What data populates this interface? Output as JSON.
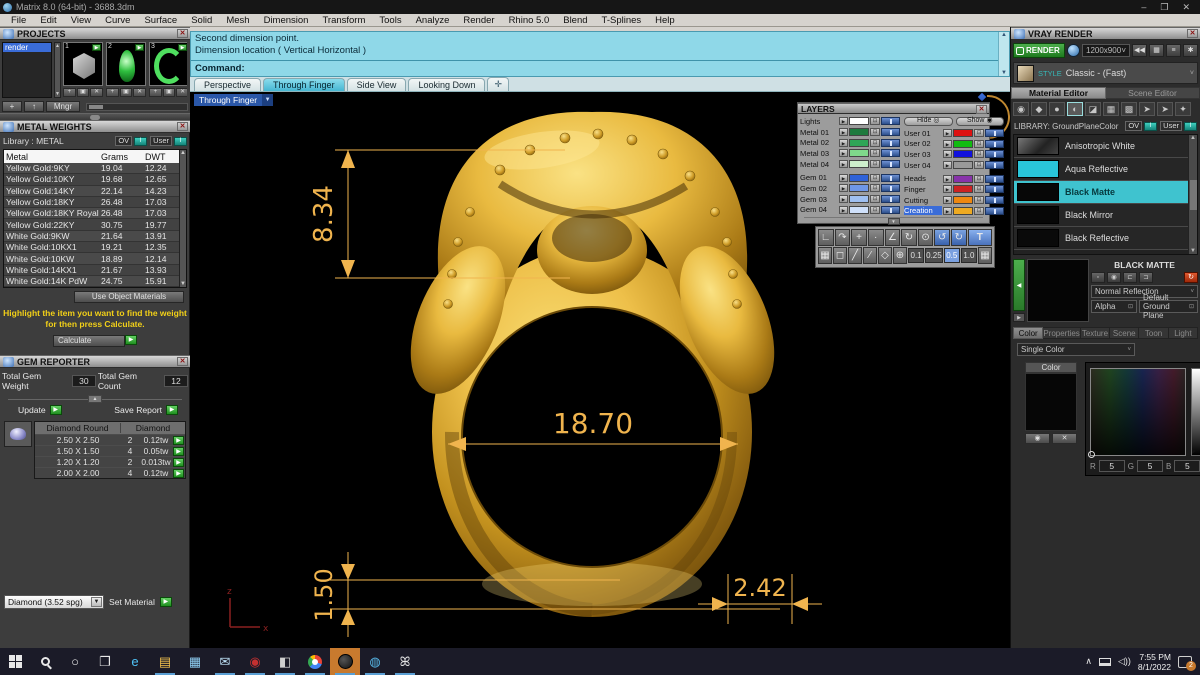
{
  "window": {
    "title": "Matrix 8.0 (64-bit) - 3688.3dm",
    "minimize": "–",
    "maximize": "❒",
    "close": "✕"
  },
  "menu": [
    "File",
    "Edit",
    "View",
    "Curve",
    "Surface",
    "Solid",
    "Mesh",
    "Dimension",
    "Transform",
    "Tools",
    "Analyze",
    "Render",
    "Rhino 5.0",
    "Blend",
    "T-Splines",
    "Help"
  ],
  "projects": {
    "title": "PROJECTS",
    "items": [
      {
        "label": "render",
        "selected": true
      }
    ],
    "thumbs": [
      {
        "label": "1"
      },
      {
        "label": "2"
      },
      {
        "label": "3"
      }
    ],
    "add_label": "+",
    "up_label": "↑",
    "mngr_label": "Mngr"
  },
  "metal_weights": {
    "title": "METAL WEIGHTS",
    "library_label": "Library :  METAL",
    "ov_label": "OV",
    "user_label": "User",
    "columns": [
      "Metal",
      "Grams",
      "DWT"
    ],
    "rows": [
      [
        "Yellow Gold:9KY",
        "19.04",
        "12.24"
      ],
      [
        "Yellow Gold:10KY",
        "19.68",
        "12.65"
      ],
      [
        "Yellow Gold:14KY",
        "22.14",
        "14.23"
      ],
      [
        "Yellow Gold:18KY",
        "26.48",
        "17.03"
      ],
      [
        "Yellow Gold:18KY Royal",
        "26.48",
        "17.03"
      ],
      [
        "Yellow Gold:22KY",
        "30.75",
        "19.77"
      ],
      [
        "White Gold:9KW",
        "21.64",
        "13.91"
      ],
      [
        "White Gold:10KX1",
        "19.21",
        "12.35"
      ],
      [
        "White Gold:10KW",
        "18.89",
        "12.14"
      ],
      [
        "White Gold:14KX1",
        "21.67",
        "13.93"
      ],
      [
        "White Gold:14K PdW",
        "24.75",
        "15.91"
      ]
    ],
    "use_object_materials_label": "Use Object Materials",
    "hint_line1": "Highlight the item you want to find the weight",
    "hint_line2": "for then press Calculate.",
    "calculate_label": "Calculate"
  },
  "gem_reporter": {
    "title": "GEM REPORTER",
    "total_weight_label": "Total Gem Weight",
    "total_weight_value": "30",
    "total_count_label": "Total Gem Count",
    "total_count_value": "12",
    "update_label": "Update",
    "save_report_label": "Save Report",
    "table_header_left": "Diamond Round",
    "table_header_right": "Diamond",
    "rows": [
      [
        "2.50 X 2.50",
        "2",
        "0.12tw"
      ],
      [
        "1.50 X 1.50",
        "4",
        "0.05tw"
      ],
      [
        "1.20 X 1.20",
        "2",
        "0.013tw"
      ],
      [
        "2.00 X 2.00",
        "4",
        "0.12tw"
      ]
    ]
  },
  "material_bar": {
    "selected_material": "Diamond   (3.52 spg)",
    "set_material_label": "Set Material"
  },
  "command": {
    "line1": "Second dimension point.",
    "line2": "Dimension location ( Vertical  Horizontal )",
    "prompt_label": "Command:"
  },
  "viewport": {
    "tabs": [
      "Perspective",
      "Through Finger",
      "Side View",
      "Looking Down"
    ],
    "active_tab": "Through Finger",
    "add_tab_label": "✛",
    "view_label": "Through Finger",
    "dimensions": {
      "vertical": "8.34",
      "inner_diameter": "18.70",
      "band_thickness": "1.50",
      "shank_width": "2.42"
    },
    "axis_x": "x",
    "axis_z": "z",
    "dimension_color": "#f0b44e"
  },
  "layers": {
    "title": "LAYERS",
    "hide_label": "Hide",
    "show_label": "Show",
    "left_rows": [
      {
        "name": "Lights",
        "color": "#ffffff"
      },
      {
        "name": "Metal 01",
        "color": "#1e7a3e"
      },
      {
        "name": "Metal 02",
        "color": "#2fa557"
      },
      {
        "name": "Metal 03",
        "color": "#7fd98b"
      },
      {
        "name": "Metal 04",
        "color": "#cdeecb"
      },
      {
        "name": "Gem 01",
        "color": "#2f62d8"
      },
      {
        "name": "Gem 02",
        "color": "#6e97e8"
      },
      {
        "name": "Gem 03",
        "color": "#9fc0f2"
      },
      {
        "name": "Gem 04",
        "color": "#cfe0fa"
      }
    ],
    "right_rows": [
      {
        "name": "User 01",
        "color": "#dd1111"
      },
      {
        "name": "User 02",
        "color": "#11bb11"
      },
      {
        "name": "User 03",
        "color": "#1111dd"
      },
      {
        "name": "User 04",
        "color": "#999999"
      },
      {
        "name": "Heads",
        "color": "#8833aa"
      },
      {
        "name": "Finger",
        "color": "#cc2222"
      },
      {
        "name": "Cutting",
        "color": "#ee8811"
      },
      {
        "name": "Creation",
        "color": "#eeaa22",
        "selected": true
      }
    ]
  },
  "snap_toolbar": {
    "row1_icons": [
      {
        "name": "perp-snap-icon",
        "glyph": "∟"
      },
      {
        "name": "tangent-snap-icon",
        "glyph": "↷"
      },
      {
        "name": "cross-snap-icon",
        "glyph": "+"
      },
      {
        "name": "point-snap-icon",
        "glyph": "·"
      },
      {
        "name": "angle-snap-icon",
        "glyph": "∠"
      },
      {
        "name": "rotate-snap-icon",
        "glyph": "↻"
      },
      {
        "name": "center-snap-icon",
        "glyph": "⊙"
      }
    ],
    "row1_blue_icons": [
      {
        "name": "undo-view-icon",
        "glyph": "↺"
      },
      {
        "name": "redo-view-icon",
        "glyph": "↻"
      }
    ],
    "big_button_label": "T",
    "row2_icons": [
      {
        "name": "grid-snap-icon",
        "glyph": "▦"
      },
      {
        "name": "box-mode-icon",
        "glyph": "◻"
      },
      {
        "name": "line-tool-icon",
        "glyph": "╱"
      },
      {
        "name": "draw-tool-icon",
        "glyph": "∕"
      },
      {
        "name": "diamond-tool-icon",
        "glyph": "◇"
      },
      {
        "name": "move-tool-icon",
        "glyph": "⊕"
      }
    ],
    "values": [
      "0.1",
      "0.25",
      "0.5",
      "1.0"
    ],
    "active_value": "0.5",
    "end_icon": {
      "name": "grid-end-icon",
      "glyph": "▦"
    }
  },
  "vray": {
    "title": "VRAY RENDER",
    "render_label": "RENDER",
    "resolution": "1200x900",
    "rewind_label": "◀◀",
    "style_label": "STYLE",
    "style_value": "Classic - (Fast)"
  },
  "material_editor": {
    "tab_material": "Material Editor",
    "tab_scene": "Scene Editor",
    "toolbar_icons": [
      {
        "name": "metal-material-icon",
        "glyph": "◉"
      },
      {
        "name": "gem-material-icon",
        "glyph": "◆"
      },
      {
        "name": "basic-material-icon",
        "glyph": "●"
      },
      {
        "name": "shaded-material-icon",
        "glyph": "◐",
        "selected": true
      },
      {
        "name": "transparency-icon",
        "glyph": "◪"
      },
      {
        "name": "pattern-icon",
        "glyph": "▦"
      },
      {
        "name": "texture-icon",
        "glyph": "▩"
      },
      {
        "name": "assign-material-icon",
        "glyph": "➤"
      },
      {
        "name": "copy-material-icon",
        "glyph": "➤"
      },
      {
        "name": "light-material-icon",
        "glyph": "✦"
      }
    ],
    "library_label": "LIBRARY:  GroundPlaneColor",
    "ov_label": "OV",
    "user_label": "User",
    "materials": [
      {
        "name": "Anisotropic White",
        "swatch": "gradient-gray"
      },
      {
        "name": "Aqua Reflective",
        "swatch": "#29c5da"
      },
      {
        "name": "Black Matte",
        "swatch": "#070707",
        "selected": true
      },
      {
        "name": "Black Mirror",
        "swatch": "#070707"
      },
      {
        "name": "Black Reflective",
        "swatch": "#0a0a0a"
      }
    ],
    "preview_title": "BLACK MATTE",
    "reflection_value": "Normal Reflection",
    "alpha_label": "Alpha",
    "ground_plane_value": "Default Ground Plane",
    "bottom_tabs": [
      "Color",
      "Properties",
      "Texture",
      "Scene",
      "Toon",
      "Light"
    ],
    "active_bottom_tab": "Color",
    "color_mode": "Single Color",
    "color_panel_label": "Color",
    "rgb": {
      "r_label": "R",
      "r_value": "5",
      "g_label": "G",
      "g_value": "5",
      "b_label": "B",
      "b_value": "5"
    }
  },
  "taskbar": {
    "icons": [
      {
        "name": "start-button",
        "glyph": " "
      },
      {
        "name": "search-icon",
        "glyph": " "
      },
      {
        "name": "cortana-icon",
        "glyph": "○"
      },
      {
        "name": "task-view-icon",
        "glyph": "❐"
      },
      {
        "name": "edge-icon",
        "glyph": "e",
        "color": "#4fc3f7"
      },
      {
        "name": "file-explorer-icon",
        "glyph": "▤",
        "color": "#f2c14e",
        "running": true
      },
      {
        "name": "store-icon",
        "glyph": "▦",
        "color": "#8ecdf2"
      },
      {
        "name": "mail-icon",
        "glyph": "✉",
        "color": "#bfe3f7",
        "running": true
      },
      {
        "name": "app-red-icon",
        "glyph": "◉",
        "color": "#c43030",
        "running": true
      },
      {
        "name": "app-gray-icon",
        "glyph": "◧",
        "color": "#cfcfcf",
        "running": true
      },
      {
        "name": "chrome-icon",
        "glyph": " ",
        "running": true
      },
      {
        "name": "matrix-icon",
        "glyph": " ",
        "active": true,
        "running": true
      },
      {
        "name": "app-blue-icon",
        "glyph": "◍",
        "color": "#58b8e8",
        "running": true
      },
      {
        "name": "zbrush-icon",
        "glyph": "ꕤ",
        "color": "#e8e8e8",
        "running": true
      }
    ],
    "time": "7:55 PM",
    "date": "8/1/2022",
    "badge": "2"
  }
}
